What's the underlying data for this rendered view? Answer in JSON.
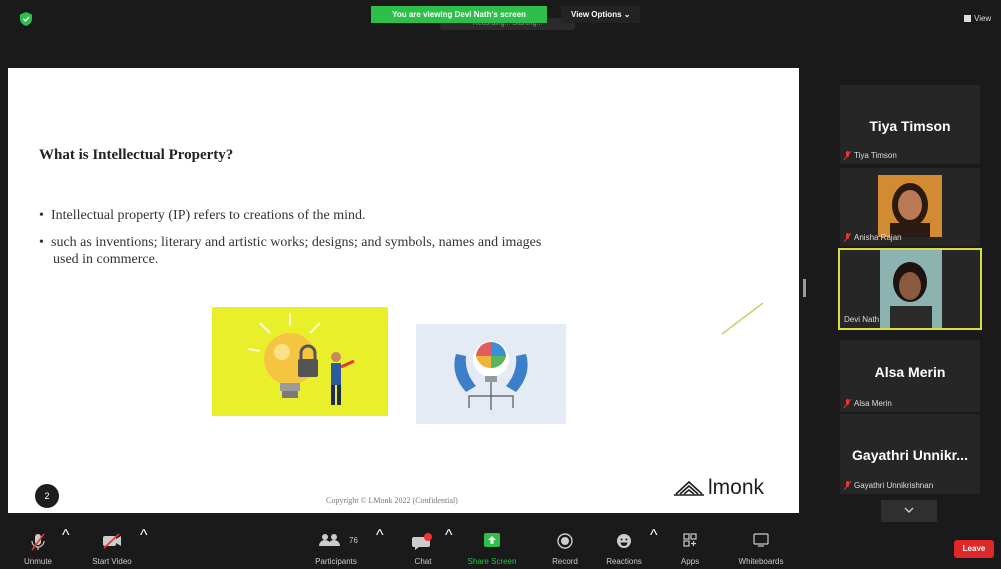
{
  "banner": {
    "viewing_text": "You are viewing Devi Nath's screen",
    "sub_text": "Recording... Starting...",
    "view_options": "View Options ⌄"
  },
  "top_right": {
    "view_label": "View"
  },
  "slide": {
    "title": "What is Intellectual Property?",
    "bullet1": "Intellectual property (IP) refers to creations of the mind.",
    "bullet2_line1": "such as inventions; literary and artistic works; designs; and symbols, names and images",
    "bullet2_line2": "used in commerce.",
    "page_number": "2",
    "copyright": "Copyright © LMonk 2022 (Confidential)",
    "logo_text": "lmonk"
  },
  "participants": [
    {
      "display": "Tiya Timson",
      "label": "Tiya Timson"
    },
    {
      "display": "",
      "label": "Anisha Rajan"
    },
    {
      "display": "",
      "label": "Devi Nath"
    },
    {
      "display": "Alsa Merin",
      "label": "Alsa Merin"
    },
    {
      "display": "Gayathri  Unnikr...",
      "label": "Gayathri Unnikrishnan"
    }
  ],
  "toolbar": {
    "unmute": "Unmute",
    "start_video": "Start Video",
    "participants": "Participants",
    "participants_count": "76",
    "chat": "Chat",
    "share_screen": "Share Screen",
    "record": "Record",
    "reactions": "Reactions",
    "apps": "Apps",
    "whiteboards": "Whiteboards",
    "leave": "Leave"
  },
  "colors": {
    "banner_green": "#2dbf4a",
    "active_speaker": "#d7df3c",
    "leave_red": "#e02828",
    "share_green": "#2dbf4a"
  }
}
